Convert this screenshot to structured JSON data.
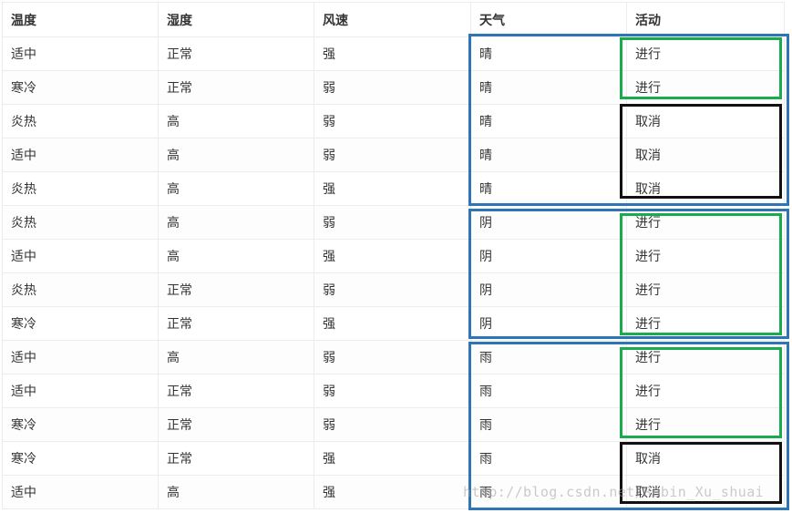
{
  "table": {
    "headers": [
      "温度",
      "湿度",
      "风速",
      "天气",
      "活动"
    ],
    "rows": [
      [
        "适中",
        "正常",
        "强",
        "晴",
        "进行"
      ],
      [
        "寒冷",
        "正常",
        "弱",
        "晴",
        "进行"
      ],
      [
        "炎热",
        "高",
        "弱",
        "晴",
        "取消"
      ],
      [
        "适中",
        "高",
        "弱",
        "晴",
        "取消"
      ],
      [
        "炎热",
        "高",
        "强",
        "晴",
        "取消"
      ],
      [
        "炎热",
        "高",
        "弱",
        "阴",
        "进行"
      ],
      [
        "适中",
        "高",
        "强",
        "阴",
        "进行"
      ],
      [
        "炎热",
        "正常",
        "弱",
        "阴",
        "进行"
      ],
      [
        "寒冷",
        "正常",
        "强",
        "阴",
        "进行"
      ],
      [
        "适中",
        "高",
        "弱",
        "雨",
        "进行"
      ],
      [
        "适中",
        "正常",
        "弱",
        "雨",
        "进行"
      ],
      [
        "寒冷",
        "正常",
        "弱",
        "雨",
        "进行"
      ],
      [
        "寒冷",
        "正常",
        "强",
        "雨",
        "取消"
      ],
      [
        "适中",
        "高",
        "强",
        "雨",
        "取消"
      ]
    ]
  },
  "highlight_colors": {
    "weather_group": "#2e75b6",
    "proceed_group": "#1aab4d",
    "cancel_group": "#111111"
  },
  "watermark": "http://blog.csdn.net/Robin_Xu_shuai"
}
